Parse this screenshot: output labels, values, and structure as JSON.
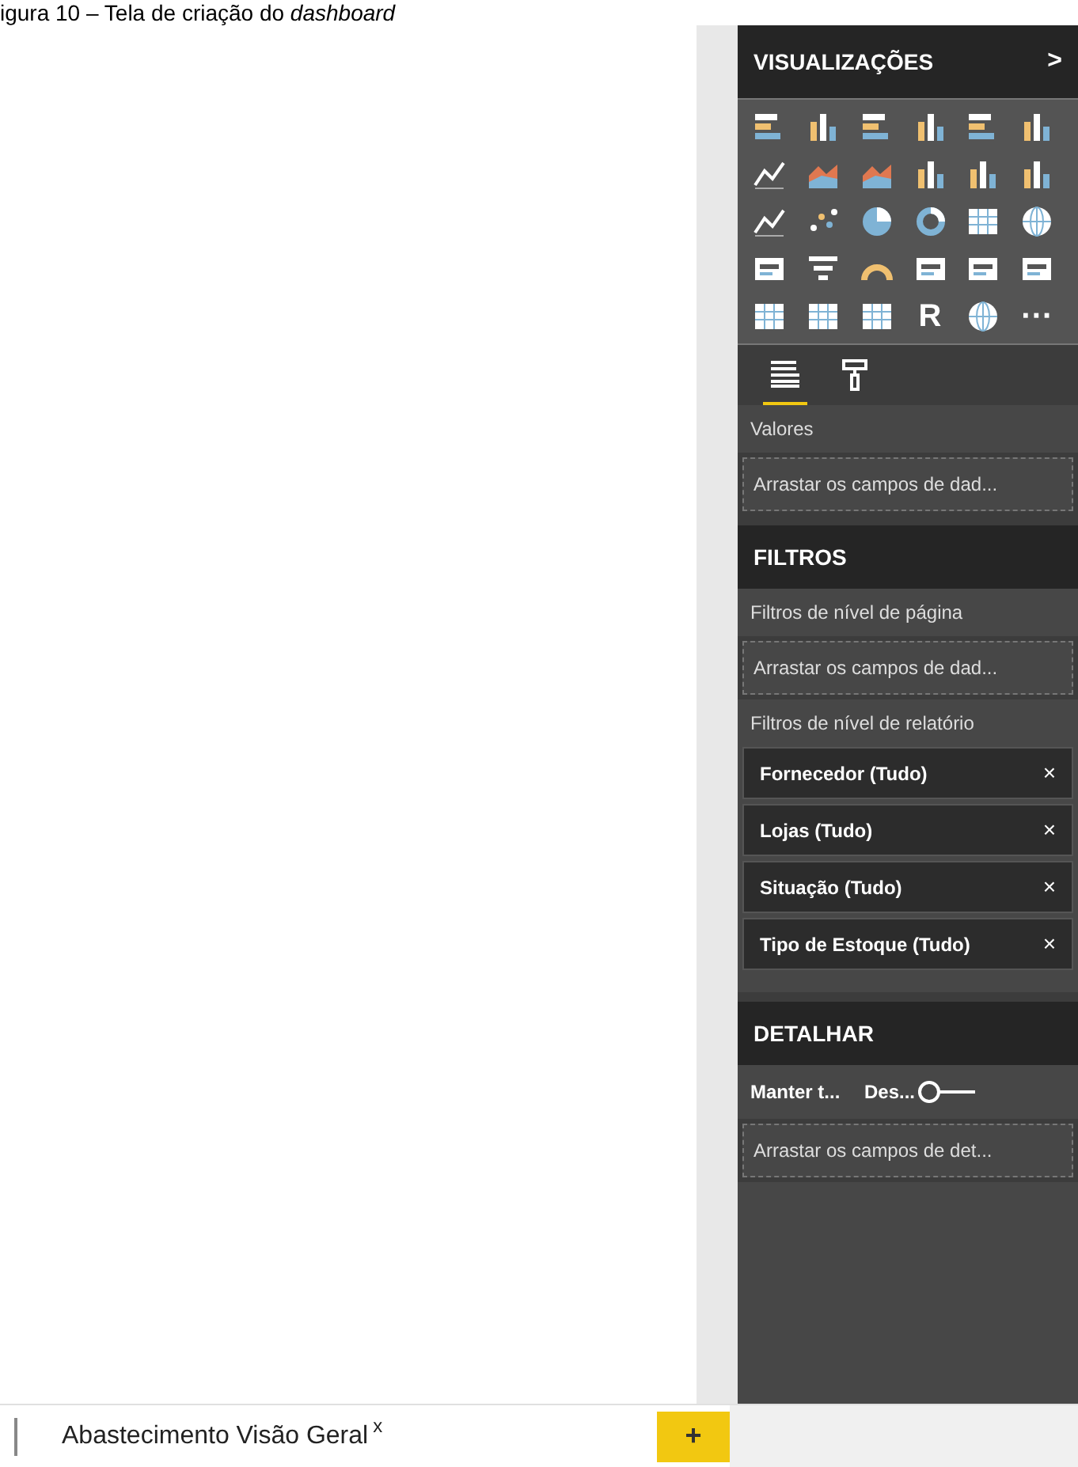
{
  "caption": "igura 10 – Tela de criação do *dashboard*",
  "visualizations": {
    "title": "VISUALIZAÇÕES",
    "collapse": ">",
    "icons": [
      {
        "kind": "hbars"
      },
      {
        "kind": "vbars"
      },
      {
        "kind": "hbars"
      },
      {
        "kind": "vbars"
      },
      {
        "kind": "hbars"
      },
      {
        "kind": "vbars"
      },
      {
        "kind": "line"
      },
      {
        "kind": "area"
      },
      {
        "kind": "area"
      },
      {
        "kind": "vbars"
      },
      {
        "kind": "vbars"
      },
      {
        "kind": "vbars"
      },
      {
        "kind": "line"
      },
      {
        "kind": "scatter"
      },
      {
        "kind": "pie"
      },
      {
        "kind": "donut"
      },
      {
        "kind": "grid"
      },
      {
        "kind": "globe"
      },
      {
        "kind": "card"
      },
      {
        "kind": "funnel"
      },
      {
        "kind": "gauge"
      },
      {
        "kind": "card"
      },
      {
        "kind": "card"
      },
      {
        "kind": "card"
      },
      {
        "kind": "grid"
      },
      {
        "kind": "grid"
      },
      {
        "kind": "grid"
      },
      {
        "kind": "glyph",
        "text": "R"
      },
      {
        "kind": "globe"
      },
      {
        "kind": "glyph",
        "text": "···"
      }
    ],
    "tabs": [
      {
        "kind": "fields",
        "selected": true
      },
      {
        "kind": "format",
        "selected": false
      }
    ],
    "values_label": "Valores",
    "values_drop": "Arrastar os campos de dad..."
  },
  "filters": {
    "title": "FILTROS",
    "page_label": "Filtros de nível de página",
    "page_drop": "Arrastar os campos de dad...",
    "report_label": "Filtros de nível de relatório",
    "chips": [
      {
        "label": "Fornecedor (Tudo)",
        "remove": "×"
      },
      {
        "label": "Lojas (Tudo)",
        "remove": "×"
      },
      {
        "label": "Situação (Tudo)",
        "remove": "×"
      },
      {
        "label": "Tipo de Estoque (Tudo)",
        "remove": "×"
      }
    ]
  },
  "drillthrough": {
    "title": "DETALHAR",
    "keep_label": "Manter t...",
    "toggle_label": "Des...",
    "toggle_on": false,
    "drop": "Arrastar os campos de det..."
  },
  "page_tabs": [
    {
      "label": "Abastecimento Visão Geral",
      "close": "x",
      "selected": true
    }
  ],
  "add_page": "+"
}
